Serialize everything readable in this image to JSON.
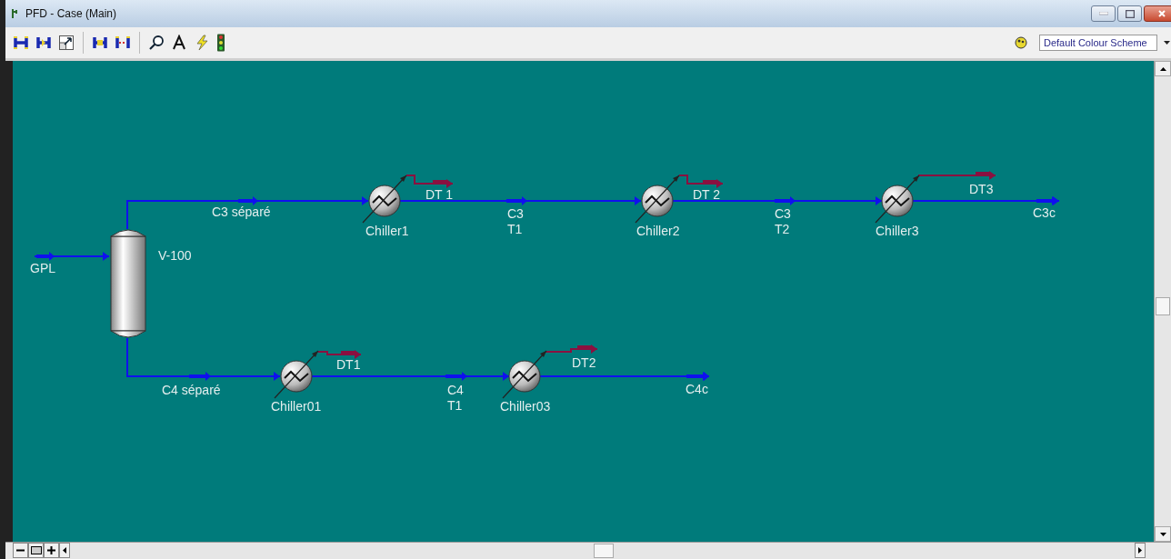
{
  "window": {
    "title": "PFD - Case (Main)"
  },
  "toolbar": {
    "colour_scheme": "Default Colour Scheme"
  },
  "pfd": {
    "units": [
      {
        "kind": "separator",
        "name": "V-100"
      },
      {
        "kind": "chiller",
        "name": "Chiller1"
      },
      {
        "kind": "chiller",
        "name": "Chiller2"
      },
      {
        "kind": "chiller",
        "name": "Chiller3"
      },
      {
        "kind": "chiller",
        "name": "Chiller01"
      },
      {
        "kind": "chiller",
        "name": "Chiller03"
      }
    ],
    "streams": [
      {
        "kind": "material",
        "name": "GPL"
      },
      {
        "kind": "material",
        "name": "C3 séparé"
      },
      {
        "kind": "energy",
        "name": "DT 1"
      },
      {
        "kind": "material",
        "name": "C3 T1"
      },
      {
        "kind": "energy",
        "name": "DT 2"
      },
      {
        "kind": "material",
        "name": "C3 T2"
      },
      {
        "kind": "energy",
        "name": "DT3"
      },
      {
        "kind": "material",
        "name": "C3c"
      },
      {
        "kind": "material",
        "name": "C4 séparé"
      },
      {
        "kind": "energy",
        "name": "DT1"
      },
      {
        "kind": "material",
        "name": "C4 T1"
      },
      {
        "kind": "energy",
        "name": "DT2"
      },
      {
        "kind": "material",
        "name": "C4c"
      }
    ]
  }
}
